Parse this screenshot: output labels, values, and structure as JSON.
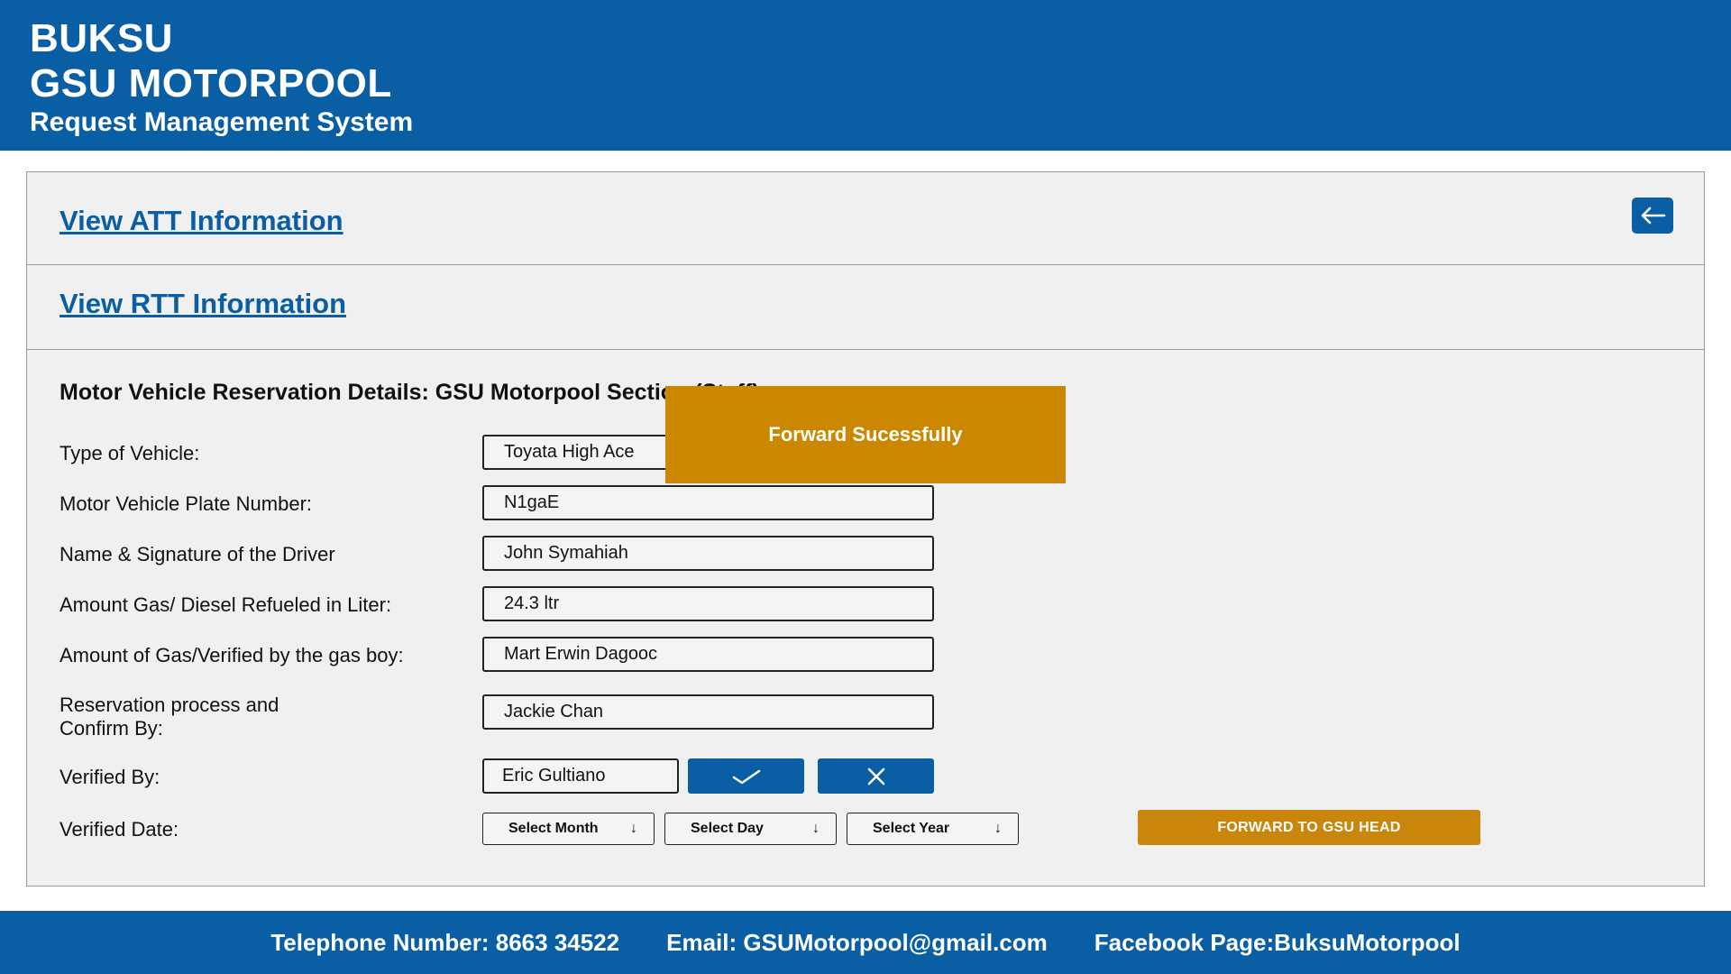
{
  "header": {
    "line1": "BUKSU",
    "line2": "GSU MOTORPOOL",
    "subtitle": "Request Management System"
  },
  "links": {
    "att": "View ATT Information",
    "rtt": "View RTT Information"
  },
  "back_icon": "arrow-left-icon",
  "section_title": "Motor Vehicle Reservation Details: GSU Motorpool Section (Staff)",
  "fields": [
    {
      "label": "Type of Vehicle:",
      "value": "Toyata High Ace"
    },
    {
      "label": "Motor Vehicle Plate Number:",
      "value": "N1gaE"
    },
    {
      "label": "Name & Signature of the Driver",
      "value": "John Symahiah"
    },
    {
      "label": "Amount Gas/ Diesel Refueled in Liter:",
      "value": "24.3 ltr"
    },
    {
      "label": "Amount of Gas/Verified by the gas boy:",
      "value": "Mart Erwin Dagooc"
    },
    {
      "label_line1": "Reservation process and",
      "label_line2": "Confirm By:",
      "value": "Jackie Chan"
    }
  ],
  "verified_by": {
    "label": "Verified By:",
    "value": "Eric Gultiano",
    "approve_icon": "check-icon",
    "reject_icon": "close-icon"
  },
  "verified_date": {
    "label": "Verified Date:",
    "month": "Select Month",
    "day": "Select Day",
    "year": "Select Year",
    "arrow": "↓"
  },
  "forward_button": "FORWARD TO GSU HEAD",
  "toast": "Forward Sucessfully",
  "footer": {
    "telephone": "Telephone Number: 8663 34522",
    "email": "Email: GSUMotorpool@gmail.com",
    "facebook": "Facebook Page:BuksuMotorpool"
  },
  "colors": {
    "primary": "#0a5fa4",
    "accent": "#c9860b",
    "panel_bg": "#f0f0f0"
  }
}
